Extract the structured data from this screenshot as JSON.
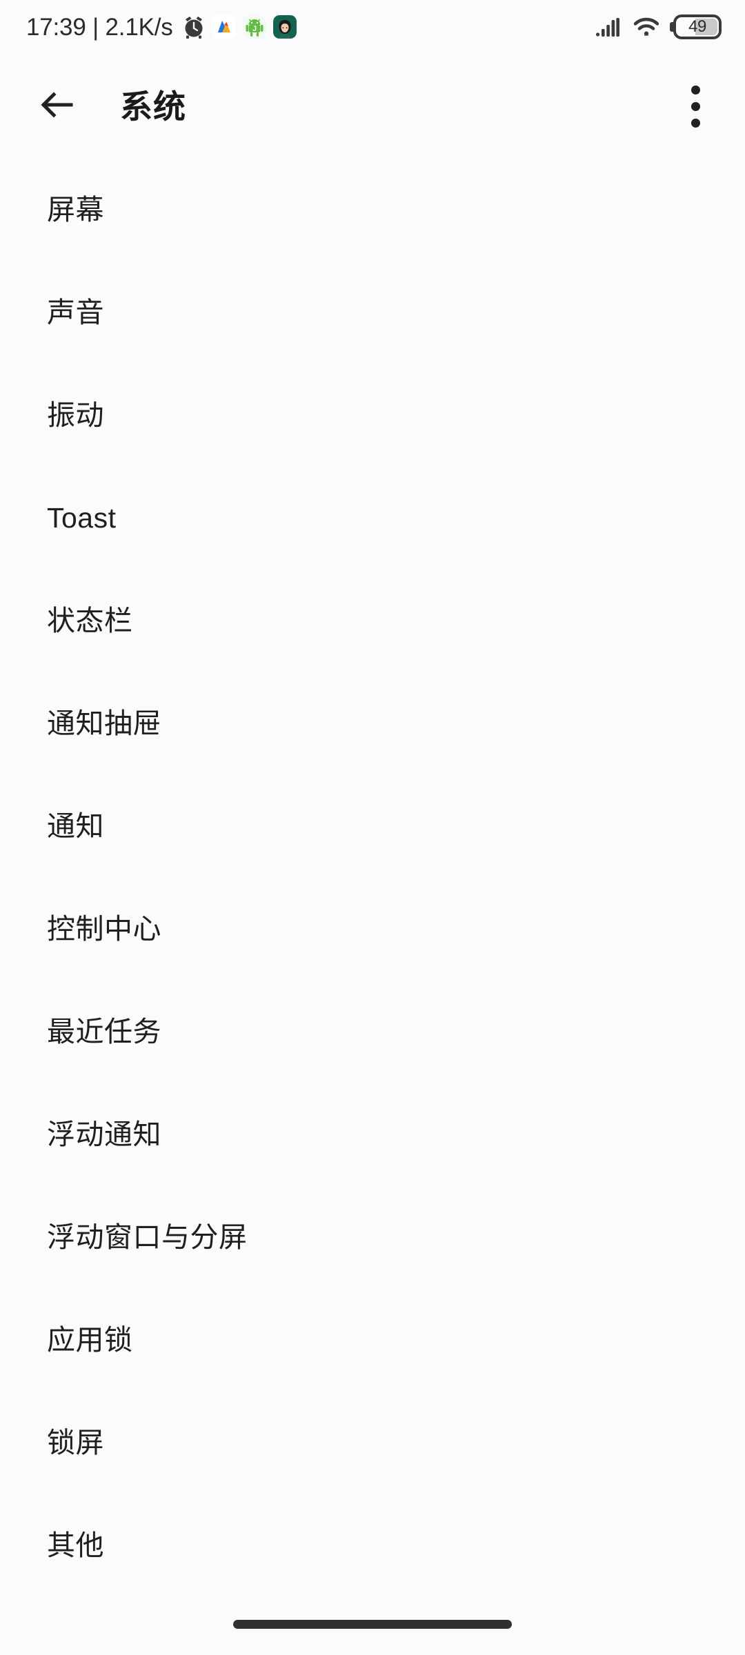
{
  "status_bar": {
    "clock": "17:39 | 2.1K/s",
    "notification_icons": [
      {
        "name": "alarm-clock-icon"
      },
      {
        "name": "amap-app-icon"
      },
      {
        "name": "android-dev-app-icon"
      },
      {
        "name": "contact-avatar-icon"
      }
    ],
    "signal_icon": "signal-bars-icon",
    "wifi_icon": "wifi-icon",
    "battery": {
      "level_text": "49",
      "level_percent": 49,
      "icon": "battery-icon"
    }
  },
  "app_bar": {
    "back_icon": "back-arrow-icon",
    "title": "系统",
    "overflow_icon": "more-vertical-icon"
  },
  "settings_list": {
    "items": [
      {
        "label": "屏幕"
      },
      {
        "label": "声音"
      },
      {
        "label": "振动"
      },
      {
        "label": "Toast"
      },
      {
        "label": "状态栏"
      },
      {
        "label": "通知抽屉"
      },
      {
        "label": "通知"
      },
      {
        "label": "控制中心"
      },
      {
        "label": "最近任务"
      },
      {
        "label": "浮动通知"
      },
      {
        "label": "浮动窗口与分屏"
      },
      {
        "label": "应用锁"
      },
      {
        "label": "锁屏"
      },
      {
        "label": "其他"
      }
    ]
  },
  "nav_bar": {
    "gesture_pill": "home-gesture-pill"
  },
  "colors": {
    "background": "#fbfbfe",
    "text_primary": "#1f1f22",
    "title": "#1b1b1d",
    "icon": "#212124",
    "pill": "#303033",
    "battery_fill": "#c9c9cc"
  }
}
